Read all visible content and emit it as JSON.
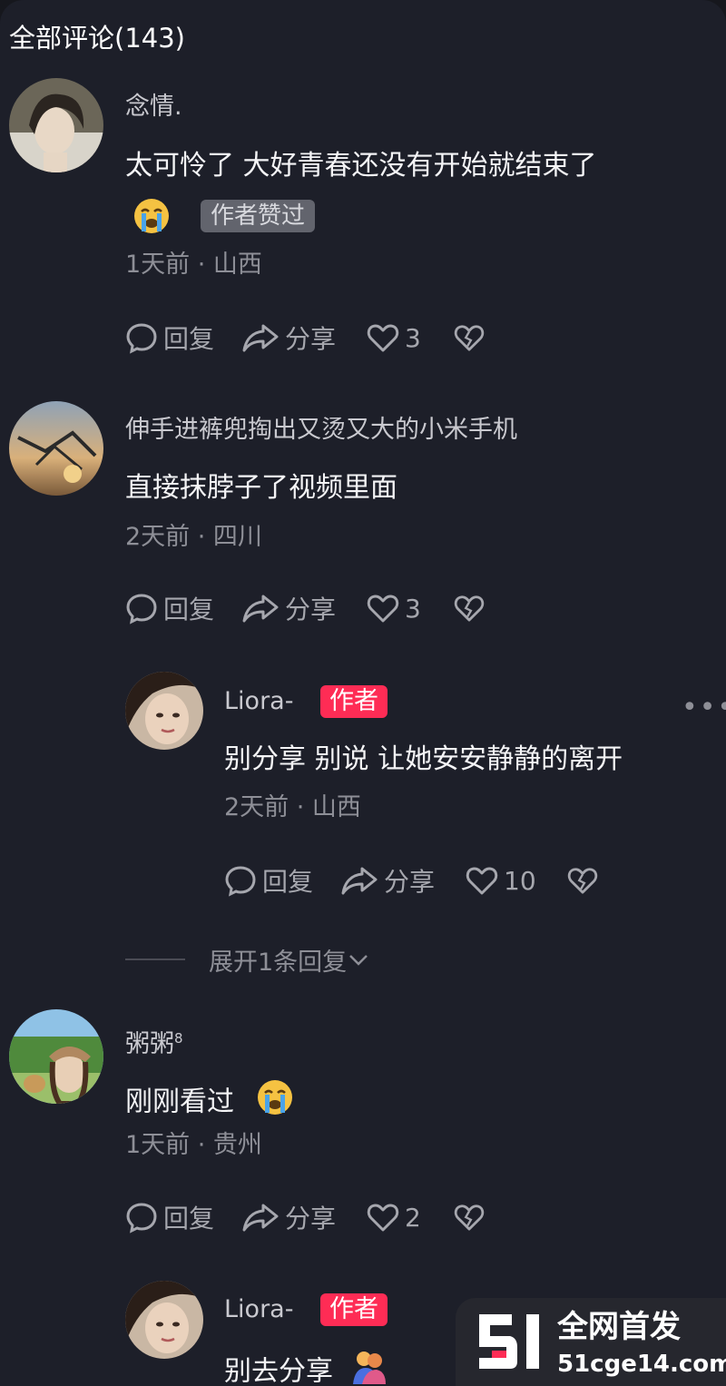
{
  "header": {
    "title": "全部评论(143)"
  },
  "comments": [
    {
      "username": "念情.",
      "text": "太可怜了 大好青春还没有开始就结束了",
      "tag": "作者赞过",
      "meta": "1天前 · 山西",
      "reply_label": "回复",
      "share_label": "分享",
      "likes": "3"
    },
    {
      "username": "伸手进裤兜掏出又烫又大的小米手机",
      "text": "直接抹脖子了视频里面",
      "meta": "2天前 · 四川",
      "reply_label": "回复",
      "share_label": "分享",
      "likes": "3"
    },
    {
      "username": "Liora-",
      "badge": "作者",
      "text": "别分享 别说 让她安安静静的离开",
      "meta": "2天前 · 山西",
      "reply_label": "回复",
      "share_label": "分享",
      "likes": "10",
      "more": "•••"
    },
    {
      "username": "粥粥",
      "username_sup": "8",
      "text": "刚刚看过",
      "meta": "1天前 · 贵州",
      "reply_label": "回复",
      "share_label": "分享",
      "likes": "2"
    },
    {
      "username": "Liora-",
      "badge": "作者",
      "text": "别去分享"
    }
  ],
  "expand_replies": "展开1条回复",
  "watermark": {
    "logo_text": "51",
    "title": "全网首发",
    "url": "51cge14.com"
  },
  "colors": {
    "background": "#1d1f29",
    "author_badge": "#fe2c55",
    "tag_bg": "#62646d",
    "muted_text": "#8e8f97"
  }
}
